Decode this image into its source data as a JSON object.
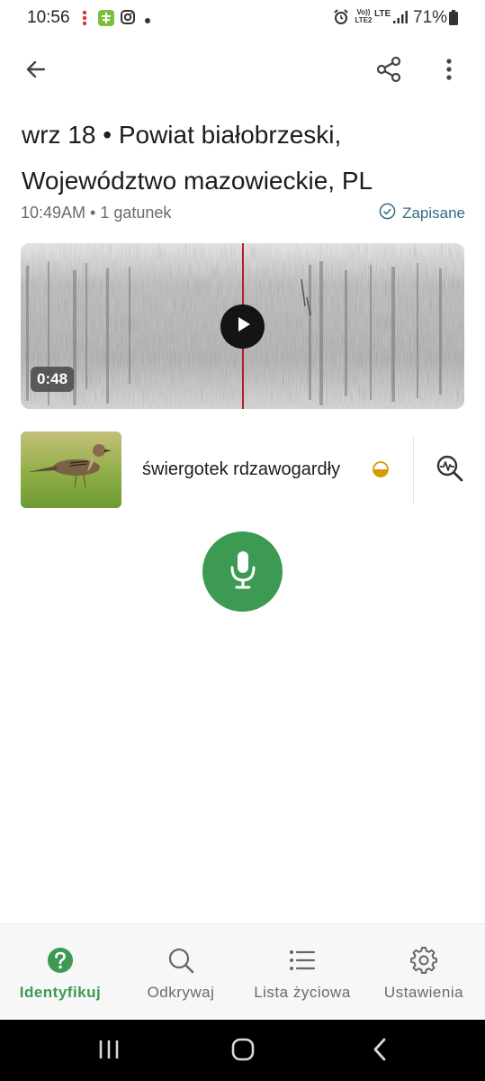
{
  "status_bar": {
    "time": "10:56",
    "battery": "71%",
    "network": "LTE",
    "network2": "Vo)) LTE2",
    "icons": [
      "notification-dots-icon",
      "app-notification-icon",
      "instagram-icon",
      "dot-icon",
      "alarm-icon",
      "signal-icon",
      "battery-icon"
    ]
  },
  "app_bar": {
    "back_icon": "arrow-left-icon",
    "share_icon": "share-icon",
    "more_icon": "more-vertical-icon"
  },
  "recording": {
    "title_line1": "wrz 18 • Powiat białobrzeski,",
    "title_line2": "Województwo mazowieckie, PL",
    "meta": "10:49AM • 1 gatunek",
    "saved_label": "Zapisane",
    "duration": "0:48",
    "playhead_fraction": 0.5
  },
  "species": {
    "name": "świergotek rdzawogardły",
    "confidence_icon": "half-circle-confidence-icon",
    "analyze_icon": "waveform-search-icon"
  },
  "mic": {
    "icon": "microphone-icon"
  },
  "bottom_nav": [
    {
      "label": "Identyfikuj",
      "icon": "question-circle-icon",
      "active": true
    },
    {
      "label": "Odkrywaj",
      "icon": "search-icon",
      "active": false
    },
    {
      "label": "Lista życiowa",
      "icon": "list-icon",
      "active": false
    },
    {
      "label": "Ustawienia",
      "icon": "gear-icon",
      "active": false
    }
  ],
  "system_nav": [
    "recents-icon",
    "home-icon",
    "back-icon"
  ],
  "colors": {
    "accent_green": "#3c9a52",
    "saved_teal": "#2f6f82",
    "playhead_red": "#b3202a",
    "confidence_gold": "#d49a00"
  }
}
